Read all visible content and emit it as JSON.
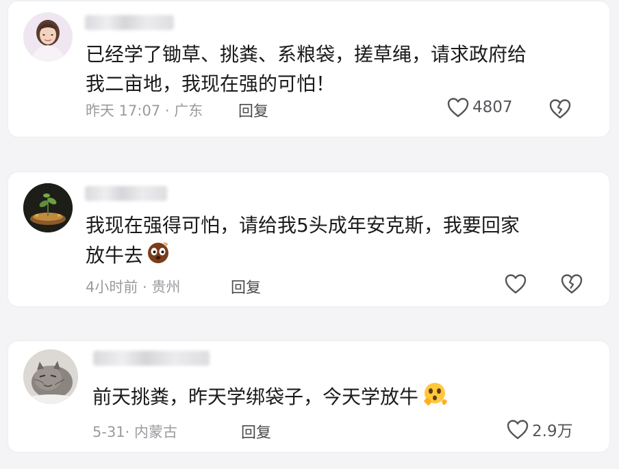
{
  "comments": [
    {
      "text_lines": [
        "已经学了锄草、挑粪、系粮袋，搓草绳，请求政府给",
        "我二亩地，我现在强的可怕！"
      ],
      "time": "昨天 17:07",
      "location": "广东",
      "time_location": "昨天 17:07 · 广东",
      "reply_label": "回复",
      "like_count": "4807",
      "avatar": "woman-photo-avatar"
    },
    {
      "text_lines": [
        "我现在强得可怕，请给我5头成年安克斯，我要回家",
        "放牛去"
      ],
      "time": "4小时前",
      "location": "贵州",
      "time_location": "4小时前 · 贵州",
      "reply_label": "回复",
      "like_count": "",
      "emoji": "embarrassed-face-emoji",
      "avatar": "plant-photo-avatar"
    },
    {
      "text_lines": [
        "前天挑粪，昨天学绑袋子，今天学放牛"
      ],
      "time": "5-31",
      "location": "内蒙古",
      "time_location": "5-31· 内蒙古",
      "reply_label": "回复",
      "like_count": "2.9万",
      "emoji": "shocked-face-emoji",
      "avatar": "cat-photo-avatar"
    }
  ],
  "icons": {
    "like": "heart-outline-icon",
    "dislike": "broken-heart-icon"
  },
  "colors": {
    "page_bg": "#f4f4f6",
    "card_bg": "#ffffff",
    "text": "#1a1a1a",
    "meta": "#9a9aa0",
    "icon": "#555559"
  }
}
